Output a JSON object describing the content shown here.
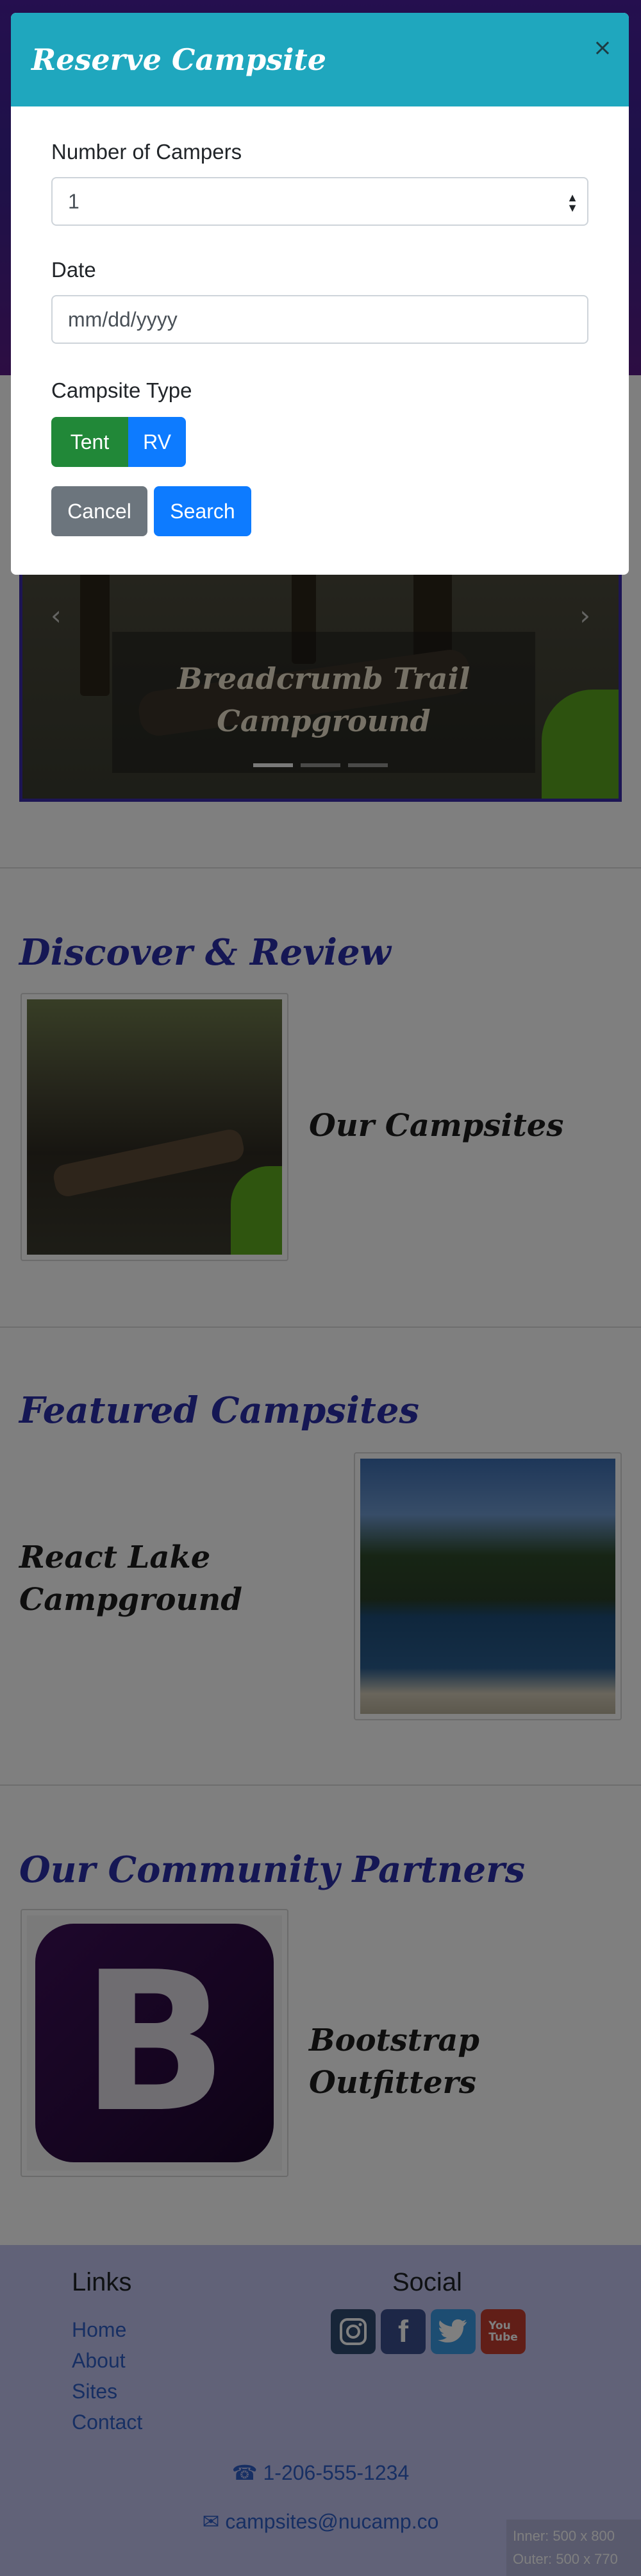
{
  "modal": {
    "title": "Reserve Campsite",
    "close_symbol": "×",
    "campers_label": "Number of Campers",
    "campers_value": "1",
    "date_label": "Date",
    "date_placeholder": "mm/dd/yyyy",
    "type_label": "Campsite Type",
    "type_options": [
      "Tent",
      "RV"
    ],
    "cancel_label": "Cancel",
    "search_label": "Search"
  },
  "carousel": {
    "caption": "Breadcrumb Trail Campground"
  },
  "sections": {
    "discover_title": "Discover & Review",
    "discover_item": "Our Campsites",
    "featured_title": "Featured Campsites",
    "featured_item": "React Lake Campground",
    "partners_title": "Our Community Partners",
    "partners_item": "Bootstrap Outfitters",
    "partners_logo_letter": "B"
  },
  "footer": {
    "links_title": "Links",
    "links": [
      "Home",
      "About",
      "Sites",
      "Contact"
    ],
    "social_title": "Social",
    "social_icons": [
      "instagram-icon",
      "facebook-icon",
      "twitter-icon",
      "youtube-icon"
    ],
    "phone": "1-206-555-1234",
    "email": "campsites@nucamp.co",
    "phone_icon": "☎",
    "email_icon": "✉"
  },
  "viewport": {
    "inner": "Inner: 500 x 800",
    "outer": "Outer: 500 x 770"
  },
  "colors": {
    "modal_header": "#1fa7be",
    "tent_button": "#218838",
    "primary": "#0d7bff",
    "secondary": "#6c757d",
    "section_title": "#2a2fa8",
    "footer_bg": "#c3c5f1"
  }
}
